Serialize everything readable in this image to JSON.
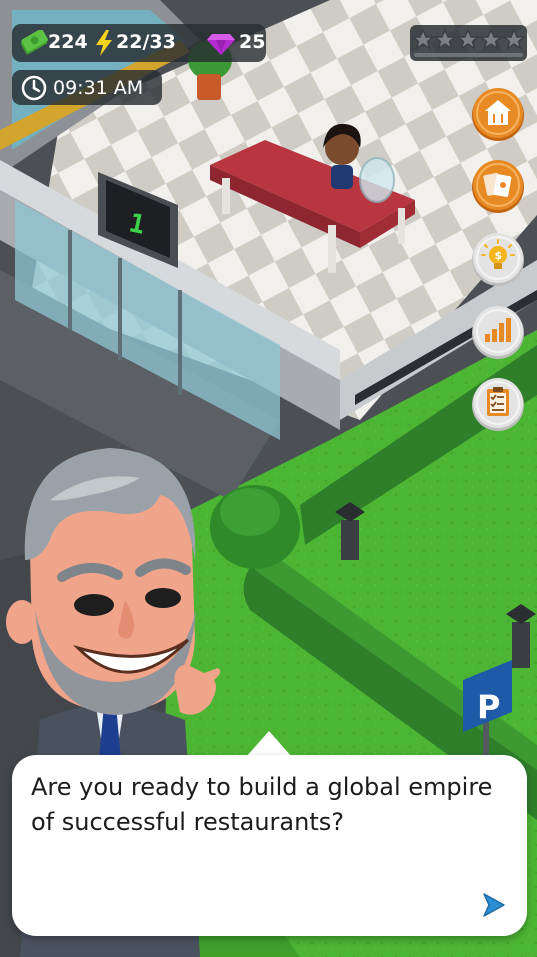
{
  "hud": {
    "cash": "224",
    "energy": "22/33",
    "gems": "25",
    "time": "09:31 AM",
    "rating_stars": 5,
    "rating_filled": 0
  },
  "scene": {
    "elevator_floor": "1",
    "parking_sign": "P"
  },
  "side_menu": [
    {
      "icon": "restaurant-house-icon"
    },
    {
      "icon": "cards-icon"
    },
    {
      "icon": "lightbulb-money-icon"
    },
    {
      "icon": "stats-chart-icon"
    },
    {
      "icon": "clipboard-tasks-icon"
    }
  ],
  "dialog": {
    "text": "Are you ready to build a global empire of successful restaurants?",
    "next_icon": "play-arrow-icon"
  },
  "colors": {
    "orange_button": "#e88a24",
    "grey_button": "#e3e3e3",
    "cash_green": "#5cc243",
    "energy_yellow": "#f5d21e",
    "gem_purple": "#b42bd1",
    "grass": "#4cb533",
    "counter_red": "#b9353f"
  }
}
